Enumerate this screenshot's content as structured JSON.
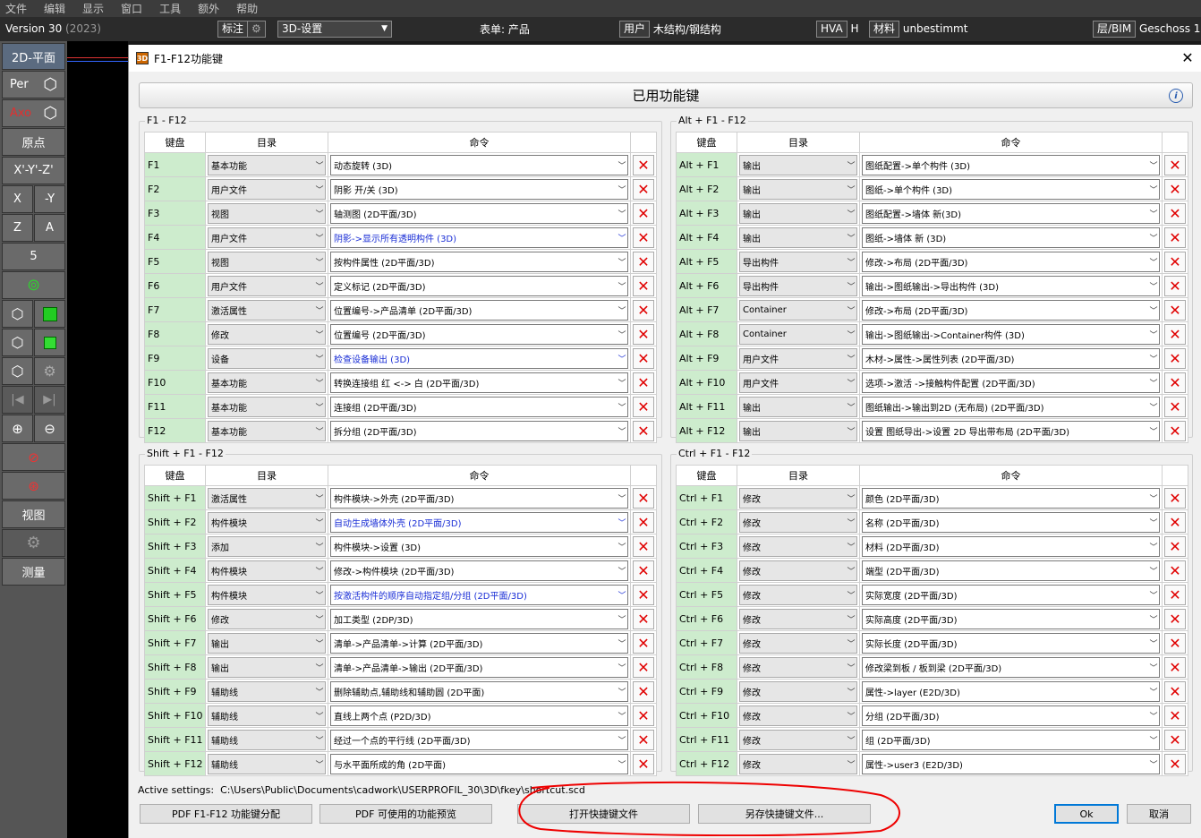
{
  "menubar": [
    "文件",
    "编辑",
    "显示",
    "窗口",
    "工具",
    "额外",
    "帮助"
  ],
  "toolbar": {
    "version": "Version 30",
    "year": "(2023)",
    "label": "标注",
    "view_setting": "3D-设置",
    "sheet_label": "表单:",
    "sheet_value": "产品",
    "user_label": "用户",
    "user_value": "木结构/钢结构",
    "hva": "HVA",
    "hva_value": "H",
    "material_label": "材料",
    "material_value": "unbestimmt",
    "layer_label": "层/BIM",
    "layer_value": "Geschoss 1"
  },
  "sidebar": {
    "plan2d": "2D-平面",
    "per": "Per",
    "axo": "Axo",
    "origin": "原点",
    "xyz": "X'-Y'-Z'",
    "x": "X",
    "minus_y": "-Y",
    "z": "Z",
    "a": "A",
    "five": "5",
    "view": "视图",
    "measure": "测量"
  },
  "dialog": {
    "title": "F1-F12功能键",
    "banner": "已用功能键",
    "active_label": "Active settings:",
    "active_path": "C:\\Users\\Public\\Documents\\cadwork\\USERPROFIL_30\\3D\\fkey\\shortcut.scd",
    "buttons": {
      "pdf_assign": "PDF F1-F12 功能键分配",
      "pdf_preview": "PDF 可使用的功能预览",
      "open_file": "打开快捷键文件",
      "save_as": "另存快捷键文件...",
      "ok": "Ok",
      "cancel": "取消"
    }
  },
  "columns": {
    "key": "键盘",
    "category": "目录",
    "command": "命令"
  },
  "groups": [
    {
      "title": "F1 - F12",
      "rows": [
        {
          "key": "F1",
          "cat": "基本功能",
          "cmd": "动态旋转 (3D)"
        },
        {
          "key": "F2",
          "cat": "用户文件",
          "cmd": "阴影 开/关 (3D)"
        },
        {
          "key": "F3",
          "cat": "视图",
          "cmd": "轴测图 (2D平面/3D)"
        },
        {
          "key": "F4",
          "cat": "用户文件",
          "cmd": "阴影->显示所有透明构件 (3D)",
          "blue": true
        },
        {
          "key": "F5",
          "cat": "视图",
          "cmd": "按构件属性 (2D平面/3D)"
        },
        {
          "key": "F6",
          "cat": "用户文件",
          "cmd": "定义标记 (2D平面/3D)"
        },
        {
          "key": "F7",
          "cat": "激活属性",
          "cmd": "位置编号->产品清单 (2D平面/3D)"
        },
        {
          "key": "F8",
          "cat": "修改",
          "cmd": "位置编号 (2D平面/3D)"
        },
        {
          "key": "F9",
          "cat": "设备",
          "cmd": "检查设备输出 (3D)",
          "blue": true
        },
        {
          "key": "F10",
          "cat": "基本功能",
          "cmd": "转换连接组 红 <-> 白 (2D平面/3D)"
        },
        {
          "key": "F11",
          "cat": "基本功能",
          "cmd": "连接组 (2D平面/3D)"
        },
        {
          "key": "F12",
          "cat": "基本功能",
          "cmd": "拆分组 (2D平面/3D)"
        }
      ]
    },
    {
      "title": "Alt + F1 - F12",
      "rows": [
        {
          "key": "Alt + F1",
          "cat": "输出",
          "cmd": "图纸配置->单个构件 (3D)"
        },
        {
          "key": "Alt + F2",
          "cat": "输出",
          "cmd": "图纸->单个构件 (3D)"
        },
        {
          "key": "Alt + F3",
          "cat": "输出",
          "cmd": "图纸配置->墙体 新(3D)"
        },
        {
          "key": "Alt + F4",
          "cat": "输出",
          "cmd": "图纸->墙体 新 (3D)"
        },
        {
          "key": "Alt + F5",
          "cat": "导出构件",
          "cmd": "修改->布局 (2D平面/3D)"
        },
        {
          "key": "Alt + F6",
          "cat": "导出构件",
          "cmd": "输出->图纸输出->导出构件 (3D)"
        },
        {
          "key": "Alt + F7",
          "cat": "Container",
          "cmd": "修改->布局 (2D平面/3D)"
        },
        {
          "key": "Alt + F8",
          "cat": "Container",
          "cmd": "输出->图纸输出->Container构件 (3D)"
        },
        {
          "key": "Alt + F9",
          "cat": "用户文件",
          "cmd": "木材->属性->属性列表 (2D平面/3D)"
        },
        {
          "key": "Alt + F10",
          "cat": "用户文件",
          "cmd": "选项->激活 ->接触构件配置 (2D平面/3D)"
        },
        {
          "key": "Alt + F11",
          "cat": "输出",
          "cmd": "图纸输出->输出到2D (无布局) (2D平面/3D)"
        },
        {
          "key": "Alt + F12",
          "cat": "输出",
          "cmd": "设置 图纸导出->设置 2D 导出带布局 (2D平面/3D)"
        }
      ]
    },
    {
      "title": "Shift + F1 - F12",
      "rows": [
        {
          "key": "Shift + F1",
          "cat": "激活属性",
          "cmd": "构件模块->外壳 (2D平面/3D)"
        },
        {
          "key": "Shift + F2",
          "cat": "构件模块",
          "cmd": "自动生成墙体外壳 (2D平面/3D)",
          "blue": true
        },
        {
          "key": "Shift + F3",
          "cat": "添加",
          "cmd": "构件模块->设置 (3D)"
        },
        {
          "key": "Shift + F4",
          "cat": "构件模块",
          "cmd": "修改->构件模块 (2D平面/3D)"
        },
        {
          "key": "Shift + F5",
          "cat": "构件模块",
          "cmd": "按激活构件的顺序自动指定组/分组 (2D平面/3D)",
          "blue": true
        },
        {
          "key": "Shift + F6",
          "cat": "修改",
          "cmd": "加工类型 (2DP/3D)"
        },
        {
          "key": "Shift + F7",
          "cat": "输出",
          "cmd": "清单->产品清单->计算 (2D平面/3D)"
        },
        {
          "key": "Shift + F8",
          "cat": "输出",
          "cmd": "清单->产品清单->输出 (2D平面/3D)"
        },
        {
          "key": "Shift + F9",
          "cat": "辅助线",
          "cmd": "删除辅助点,辅助线和辅助圆 (2D平面)"
        },
        {
          "key": "Shift + F10",
          "cat": "辅助线",
          "cmd": "直线上两个点 (P2D/3D)"
        },
        {
          "key": "Shift + F11",
          "cat": "辅助线",
          "cmd": "经过一个点的平行线 (2D平面/3D)"
        },
        {
          "key": "Shift + F12",
          "cat": "辅助线",
          "cmd": "与水平面所成的角 (2D平面)"
        }
      ]
    },
    {
      "title": "Ctrl + F1 - F12",
      "rows": [
        {
          "key": "Ctrl + F1",
          "cat": "修改",
          "cmd": "颜色 (2D平面/3D)"
        },
        {
          "key": "Ctrl + F2",
          "cat": "修改",
          "cmd": "名称 (2D平面/3D)"
        },
        {
          "key": "Ctrl + F3",
          "cat": "修改",
          "cmd": "材料 (2D平面/3D)"
        },
        {
          "key": "Ctrl + F4",
          "cat": "修改",
          "cmd": "端型 (2D平面/3D)"
        },
        {
          "key": "Ctrl + F5",
          "cat": "修改",
          "cmd": "实际宽度 (2D平面/3D)"
        },
        {
          "key": "Ctrl + F6",
          "cat": "修改",
          "cmd": "实际高度 (2D平面/3D)"
        },
        {
          "key": "Ctrl + F7",
          "cat": "修改",
          "cmd": "实际长度 (2D平面/3D)"
        },
        {
          "key": "Ctrl + F8",
          "cat": "修改",
          "cmd": "修改梁到板 / 板到梁 (2D平面/3D)"
        },
        {
          "key": "Ctrl + F9",
          "cat": "修改",
          "cmd": "属性->layer (E2D/3D)"
        },
        {
          "key": "Ctrl + F10",
          "cat": "修改",
          "cmd": "分组 (2D平面/3D)"
        },
        {
          "key": "Ctrl + F11",
          "cat": "修改",
          "cmd": "组 (2D平面/3D)"
        },
        {
          "key": "Ctrl + F12",
          "cat": "修改",
          "cmd": "属性->user3 (E2D/3D)"
        }
      ]
    }
  ]
}
